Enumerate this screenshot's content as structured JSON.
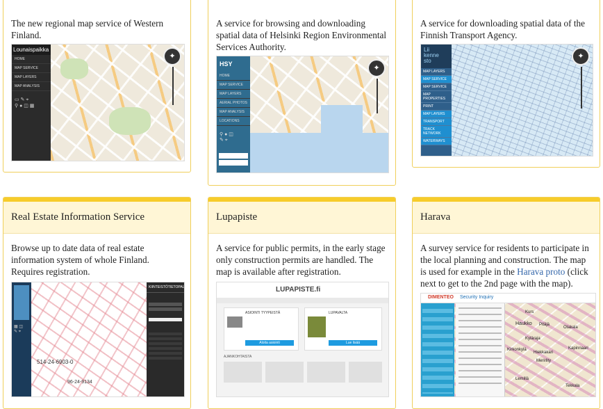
{
  "cards": {
    "lounais": {
      "description": "The new regional map service of Western Finland.",
      "shot": {
        "logo": "Lounaispaikka",
        "menu": [
          "HOME",
          "MAP SERVICE",
          "MAP LAYERS",
          "MAP ANALYSIS"
        ]
      }
    },
    "hsy": {
      "description": "A service for browsing and downloading spatial data of Helsinki Region Environmental Services Authority.",
      "shot": {
        "logo": "HSY",
        "menu": [
          "HOME",
          "MAP SERVICE",
          "MAP LAYERS",
          "AERIAL PHOTOS",
          "MAP ANALYSIS",
          "LOCATIONS"
        ]
      }
    },
    "liikennevirasto": {
      "description": "A service for downloading spatial data of the Finnish Transport Agency.",
      "shot": {
        "logo_lines": [
          "Lii",
          "kenne",
          "sto"
        ],
        "menu": [
          "MAP LAYERS",
          "MAP SERVICE",
          "MAP SERVICE",
          "MAP PROPERTIES",
          "PRINT",
          "MAP LAYERS",
          "TRANSPORT",
          "TRACK NETWORK",
          "WATERWAYS"
        ]
      }
    },
    "real_estate": {
      "title": "Real Estate Information Service",
      "description": "Browse up to date data of real estate information system of whole Finland. Requires registration.",
      "shot": {
        "parcel_label_1": "514-24-6903-0",
        "parcel_label_2": "96-24-9134",
        "panel_title": "KIINTEISTÖTIETOPALVELU"
      }
    },
    "lupapiste": {
      "title": "Lupapiste",
      "description": "A service for public permits, in the early stage only construction permits are handled. The map is available after registration.",
      "shot": {
        "logo": "LUPAPISTE.fi",
        "section_1": "ASIOINTI TYYPEISTÄ",
        "section_2": "LUPAVALTA",
        "section_3": "AJANKOHTAISTA",
        "button_1": "Aloita asiointi",
        "button_2": "Lue lisää"
      }
    },
    "harava": {
      "title": "Harava",
      "description_before": "A survey service for residents to participate in the local planning and construction. The map is used for example in the",
      "link": "Harava proto",
      "description_after": "(click next to get to the 2nd page with the map).",
      "shot": {
        "logo": "DIMENTEO",
        "header_text": "Security Inquiry",
        "places": [
          "Kurs",
          "Haukko",
          "Pitäjä",
          "Otakala",
          "Kyläraja",
          "Kirkonkylä",
          "Hiekkakari",
          "Kapinnaari",
          "Merirlity",
          "Lemillä",
          "Tekkala"
        ]
      }
    }
  },
  "colors": {
    "card_border": "#f0cf5a",
    "card_header_bg": "#fff6d6",
    "card_accent": "#f7cc2a",
    "link": "#3366aa"
  }
}
